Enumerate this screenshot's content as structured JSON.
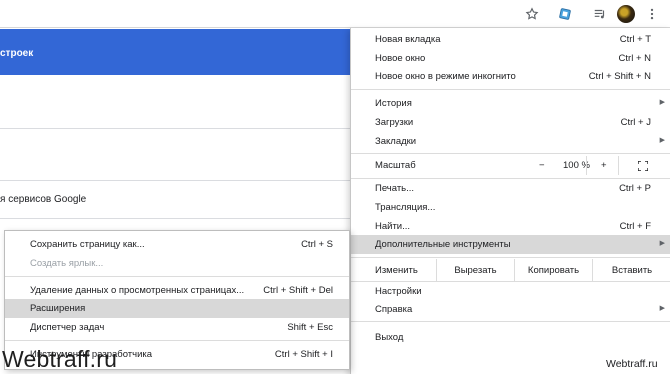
{
  "page": {
    "header_fragment": "строек",
    "text_fragment": "я сервисов Google"
  },
  "menu": {
    "new_tab": {
      "label": "Новая вкладка",
      "shortcut": "Ctrl + T"
    },
    "new_window": {
      "label": "Новое окно",
      "shortcut": "Ctrl + N"
    },
    "incognito": {
      "label": "Новое окно в режиме инкогнито",
      "shortcut": "Ctrl + Shift + N"
    },
    "history": {
      "label": "История"
    },
    "downloads": {
      "label": "Загрузки",
      "shortcut": "Ctrl + J"
    },
    "bookmarks": {
      "label": "Закладки"
    },
    "zoom": {
      "label": "Масштаб",
      "minus": "−",
      "value": "100 %",
      "plus": "+"
    },
    "print": {
      "label": "Печать...",
      "shortcut": "Ctrl + P"
    },
    "cast": {
      "label": "Трансляция..."
    },
    "find": {
      "label": "Найти...",
      "shortcut": "Ctrl + F"
    },
    "more_tools": {
      "label": "Дополнительные инструменты"
    },
    "edit": {
      "label": "Изменить",
      "cut": "Вырезать",
      "copy": "Копировать",
      "paste": "Вставить"
    },
    "settings": {
      "label": "Настройки"
    },
    "help": {
      "label": "Справка"
    },
    "exit": {
      "label": "Выход"
    }
  },
  "submenu": {
    "save_page": {
      "label": "Сохранить страницу как...",
      "shortcut": "Ctrl + S"
    },
    "create_shortcut": {
      "label": "Создать ярлык..."
    },
    "clear_data": {
      "label": "Удаление данных о просмотренных страницах...",
      "shortcut": "Ctrl + Shift + Del"
    },
    "extensions": {
      "label": "Расширения"
    },
    "task_manager": {
      "label": "Диспетчер задач",
      "shortcut": "Shift + Esc"
    },
    "dev_tools": {
      "label": "Инструменты разработчика",
      "shortcut": "Ctrl + Shift + I"
    }
  },
  "watermark": {
    "left": "Webtraff.ru",
    "right": "Webtraff.ru"
  },
  "icons": [
    "star-icon",
    "extension-icon",
    "media-icon",
    "avatar",
    "more-vert-icon",
    "chevron-right-icon",
    "fullscreen-icon"
  ],
  "colors": {
    "accent": "#3367d6",
    "highlight": "#d8d8d8"
  }
}
